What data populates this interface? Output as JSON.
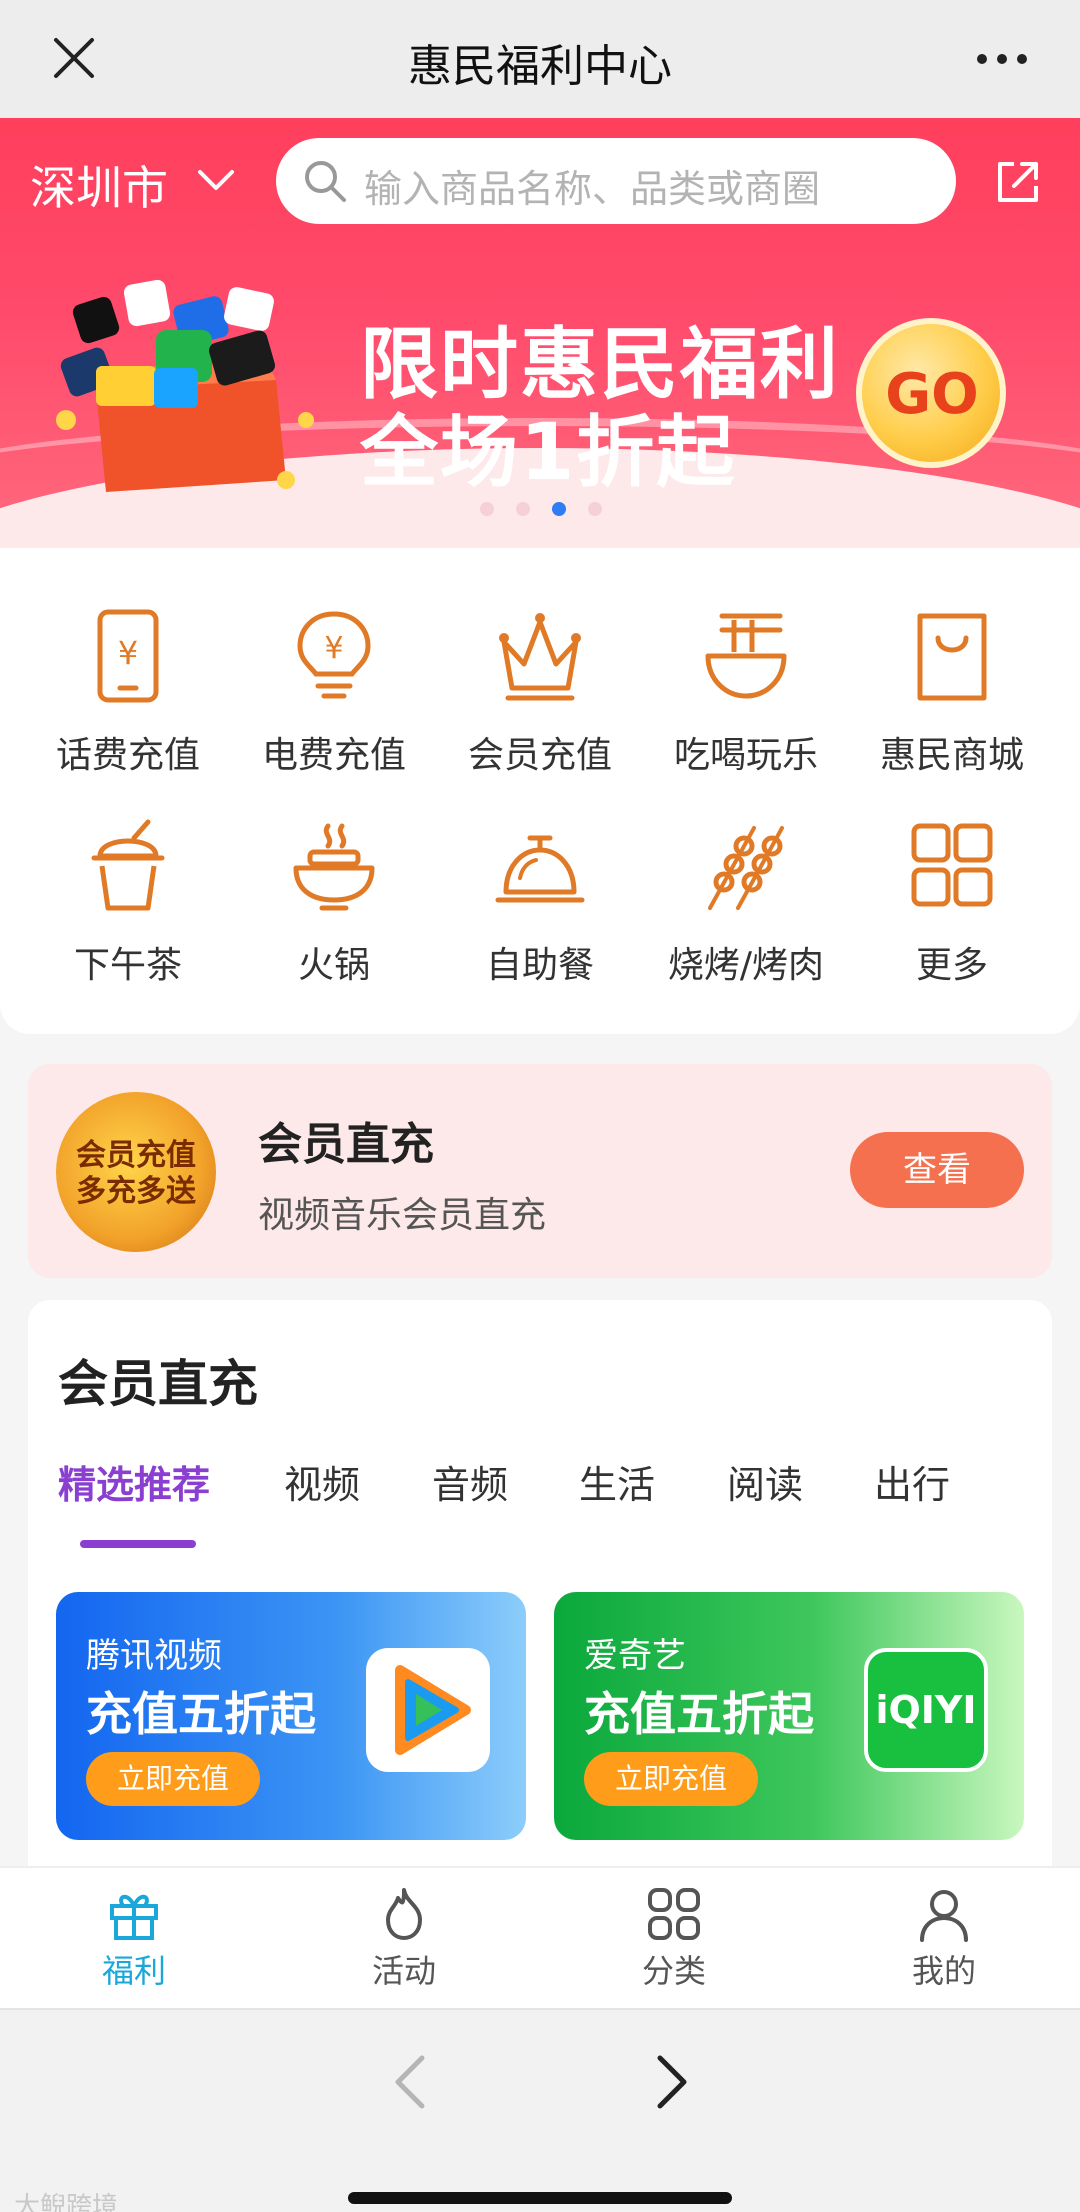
{
  "window": {
    "title": "惠民福利中心"
  },
  "header": {
    "city": "深圳市",
    "search_placeholder": "输入商品名称、品类或商圈"
  },
  "banner": {
    "line1": "限时惠民福利",
    "line2": "全场1折起",
    "go_label": "GO",
    "carousel": {
      "count": 4,
      "active_index": 2
    }
  },
  "categories": [
    {
      "label": "话费充值",
      "icon": "phone-yen-icon"
    },
    {
      "label": "电费充值",
      "icon": "bulb-yen-icon"
    },
    {
      "label": "会员充值",
      "icon": "crown-icon"
    },
    {
      "label": "吃喝玩乐",
      "icon": "noodle-bowl-icon"
    },
    {
      "label": "惠民商城",
      "icon": "shopping-bag-icon"
    },
    {
      "label": "下午茶",
      "icon": "bubble-tea-icon"
    },
    {
      "label": "火锅",
      "icon": "hotpot-icon"
    },
    {
      "label": "自助餐",
      "icon": "cloche-icon"
    },
    {
      "label": "烧烤/烤肉",
      "icon": "skewer-icon"
    },
    {
      "label": "更多",
      "icon": "grid-icon"
    }
  ],
  "member_banner": {
    "badge_text": "会员充值 多充多送",
    "title": "会员直充",
    "subtitle": "视频音乐会员直充",
    "button": "查看"
  },
  "section": {
    "title": "会员直充",
    "tabs": [
      "精选推荐",
      "视频",
      "音频",
      "生活",
      "阅读",
      "出行"
    ],
    "active_tab": 0,
    "products": [
      {
        "brand": "腾讯视频",
        "deal": "充值五折起",
        "cta": "立即充值"
      },
      {
        "brand": "爱奇艺",
        "deal": "充值五折起",
        "cta": "立即充值",
        "logo_text": "iQIYI"
      }
    ]
  },
  "tabbar": {
    "items": [
      {
        "label": "福利",
        "icon": "gift-icon",
        "active": true
      },
      {
        "label": "活动",
        "icon": "flame-icon",
        "active": false
      },
      {
        "label": "分类",
        "icon": "grid-icon",
        "active": false
      },
      {
        "label": "我的",
        "icon": "user-icon",
        "active": false
      }
    ]
  },
  "watermark": "大鲵跨境",
  "colors": {
    "banner_red": "#ff3f5c",
    "icon_orange": "#e07a26",
    "tab_active_purple": "#8a3fd1",
    "tabbar_active": "#1aa7d9",
    "view_button": "#f5704e"
  }
}
